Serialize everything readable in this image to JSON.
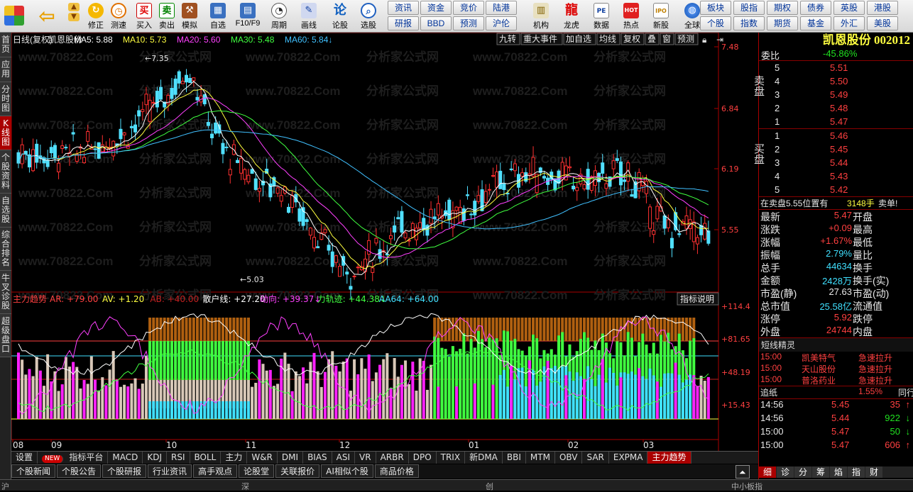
{
  "toolbar": {
    "buttons": [
      "修正",
      "测速",
      "买入",
      "卖出",
      "模拟",
      "自选",
      "F10/F9",
      "周期",
      "画线",
      "论股",
      "选股",
      "机构",
      "龙虎",
      "数据",
      "热点",
      "新股",
      "全球"
    ],
    "quick_row1": [
      "资讯",
      "资金",
      "竞价",
      "陆港",
      "板块",
      "股指",
      "期权",
      "债券",
      "英股",
      "港股"
    ],
    "quick_row2": [
      "研报",
      "BBD",
      "预测",
      "沪伦",
      "个股",
      "指数",
      "期货",
      "基金",
      "外汇",
      "美股"
    ]
  },
  "leftnav": [
    "首页",
    "应用",
    "分时图",
    "K线图",
    "个股资料",
    "自选股",
    "综合排名",
    "牛叉诊股",
    "超级盘口"
  ],
  "main": {
    "header_left": "日线(复权)",
    "stock_name": "凯恩股份",
    "ma": [
      {
        "label": "MA5: 5.88",
        "color": "#ffffff"
      },
      {
        "label": "MA10: 5.73",
        "color": "#ffff40"
      },
      {
        "label": "MA20: 5.60",
        "color": "#ff40ff"
      },
      {
        "label": "MA30: 5.48",
        "color": "#40ff40"
      },
      {
        "label": "MA60: 5.84↓",
        "color": "#40c0ff"
      }
    ],
    "header_buttons": [
      "九转",
      "重大事件",
      "加自选",
      "均线",
      "复权",
      "叠",
      "窗",
      "预测"
    ],
    "price_ticks": [
      "7.48",
      "6.84",
      "6.19",
      "5.55"
    ],
    "hi_label": "7.35",
    "lo_label": "5.03",
    "watermark": "www.70822.Com",
    "watermark2": "分析家公式网",
    "indicator": {
      "name": "主力趋势",
      "items": [
        {
          "label": "AR: +79.00",
          "color": "#ff4040"
        },
        {
          "label": "AV: +1.20",
          "color": "#ffff40"
        },
        {
          "label": "AB: +40.00",
          "color": "#c02020"
        },
        {
          "label": "散户线: +27.20",
          "color": "#ffffff"
        },
        {
          "label": "动向: +39.37↓",
          "color": "#ff40ff"
        },
        {
          "label": "力轨迹: +44.38↓",
          "color": "#40ff40"
        },
        {
          "label": "AA64: +64.00",
          "color": "#40e0ff"
        }
      ],
      "help": "指标说明",
      "ticks": [
        "+114.4",
        "+81.65",
        "+48.19",
        "+15.43"
      ]
    },
    "months": [
      "08",
      "09",
      "10",
      "11",
      "12",
      "01",
      "02",
      "03"
    ]
  },
  "right": {
    "title": "凯恩股份 002012",
    "weibi_label": "委比",
    "weibi_val": "-45.86%",
    "sell_label": "卖盘",
    "buy_label": "买盘",
    "sells": [
      {
        "lv": "5",
        "p": "5.51"
      },
      {
        "lv": "4",
        "p": "5.50"
      },
      {
        "lv": "3",
        "p": "5.49"
      },
      {
        "lv": "2",
        "p": "5.48"
      },
      {
        "lv": "1",
        "p": "5.47"
      }
    ],
    "buys": [
      {
        "lv": "1",
        "p": "5.46"
      },
      {
        "lv": "2",
        "p": "5.45"
      },
      {
        "lv": "3",
        "p": "5.44"
      },
      {
        "lv": "4",
        "p": "5.43"
      },
      {
        "lv": "5",
        "p": "5.42"
      }
    ],
    "order_note": "在卖盘5.55位置有",
    "order_qty": "3148手",
    "order_tail": "卖单!",
    "stats": [
      {
        "l1": "最新",
        "v1": "5.47",
        "c1": "#ff4040",
        "l2": "开盘"
      },
      {
        "l1": "涨跌",
        "v1": "+0.09",
        "c1": "#ff4040",
        "l2": "最高"
      },
      {
        "l1": "涨幅",
        "v1": "+1.67%",
        "c1": "#ff4040",
        "l2": "最低"
      },
      {
        "l1": "振幅",
        "v1": "2.79%",
        "c1": "#40e0ff",
        "l2": "量比"
      },
      {
        "l1": "总手",
        "v1": "44634",
        "c1": "#40e0ff",
        "l2": "换手"
      },
      {
        "l1": "金额",
        "v1": "2428万",
        "c1": "#40e0ff",
        "l2": "换手(实)"
      },
      {
        "l1": "市盈(静)",
        "v1": "27.63",
        "c1": "#e8e8e8",
        "l2": "市盈(动)"
      },
      {
        "l1": "总市值",
        "v1": "25.58亿",
        "c1": "#40e0ff",
        "l2": "流通值"
      },
      {
        "l1": "涨停",
        "v1": "5.92",
        "c1": "#ff4040",
        "l2": "跌停"
      },
      {
        "l1": "外盘",
        "v1": "24744",
        "c1": "#ff4040",
        "l2": "内盘"
      }
    ],
    "sprite_title": "短线精灵",
    "sprite": [
      {
        "t": "15:00",
        "n": "凯美特气",
        "e": "急速拉升"
      },
      {
        "t": "15:00",
        "n": "天山股份",
        "e": "急速拉升"
      },
      {
        "t": "15:00",
        "n": "普洛药业",
        "e": "急速拉升"
      }
    ],
    "zhengu_label": "追纸",
    "zhengu_val": "1.55%",
    "zhengu_tail": "同行",
    "ticks": [
      {
        "t": "14:56",
        "p": "5.45",
        "q": "35",
        "dir": "up"
      },
      {
        "t": "14:56",
        "p": "5.44",
        "q": "922",
        "dir": "down"
      },
      {
        "t": "15:00",
        "p": "5.47",
        "q": "50",
        "dir": "down"
      },
      {
        "t": "15:00",
        "p": "5.47",
        "q": "606",
        "dir": "up"
      }
    ],
    "bottom_tabs": [
      "细",
      "诊",
      "分",
      "筹",
      "焰",
      "指",
      "财"
    ]
  },
  "tabs1": [
    "设置",
    "NEW",
    "指标平台",
    "MACD",
    "KDJ",
    "RSI",
    "BOLL",
    "主力",
    "W&R",
    "DMI",
    "BIAS",
    "ASI",
    "VR",
    "ARBR",
    "DPO",
    "TRIX",
    "新DMA",
    "BBI",
    "MTM",
    "OBV",
    "SAR",
    "EXPMA",
    "主力趋势"
  ],
  "tabs2": [
    "个股新闻",
    "个股公告",
    "个股研报",
    "行业资讯",
    "高手观点",
    "论股堂",
    "关联报价",
    "AI相似个股",
    "商品价格"
  ],
  "status": [
    "沪",
    "深",
    "创",
    "中小板指"
  ]
}
